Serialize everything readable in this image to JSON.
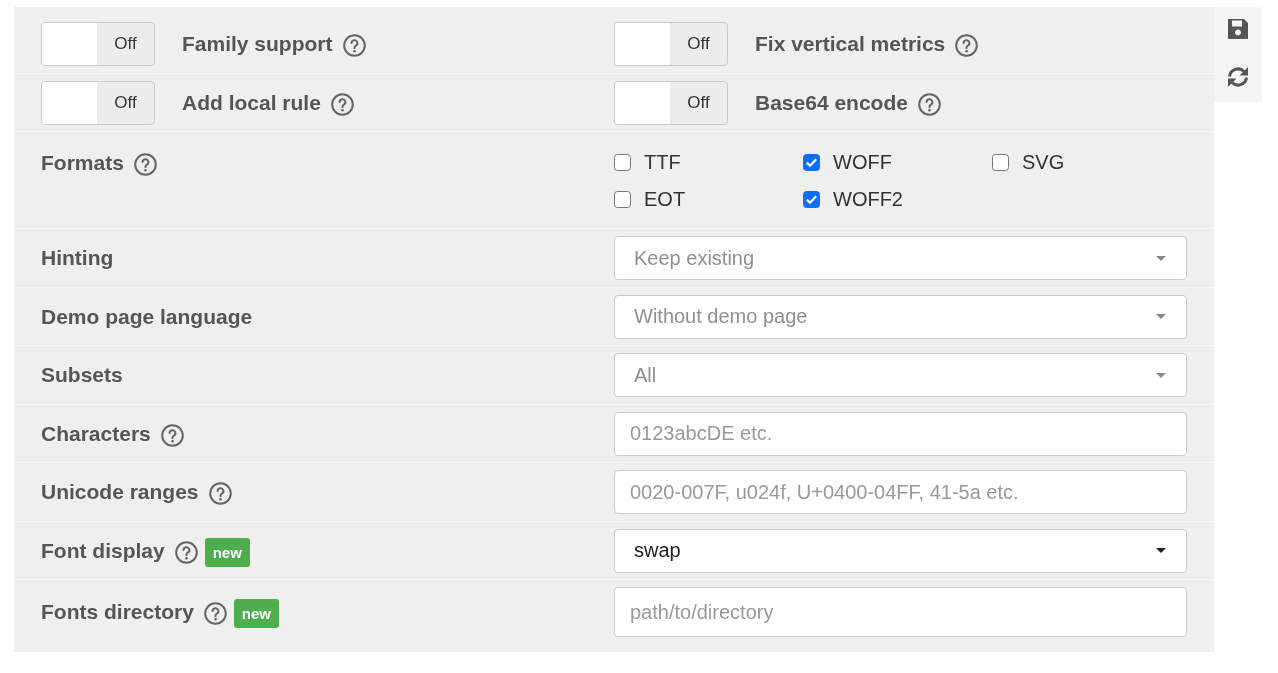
{
  "options_panel": {
    "toggles": [
      {
        "label": "Family support",
        "help": true,
        "on": false,
        "state_label": "Off"
      },
      {
        "label": "Fix vertical metrics",
        "help": true,
        "on": false,
        "state_label": "Off"
      },
      {
        "label": "Add local rule",
        "help": true,
        "on": false,
        "state_label": "Off"
      },
      {
        "label": "Base64 encode",
        "help": true,
        "on": false,
        "state_label": "Off"
      }
    ],
    "formats": {
      "label": "Formats",
      "help": true,
      "options": [
        {
          "label": "TTF",
          "checked": false
        },
        {
          "label": "WOFF",
          "checked": true
        },
        {
          "label": "SVG",
          "checked": false
        },
        {
          "label": "EOT",
          "checked": false
        },
        {
          "label": "WOFF2",
          "checked": true
        }
      ]
    },
    "settings": [
      {
        "label": "Hinting",
        "help": false,
        "kind": "select",
        "placeholder": "Keep existing"
      },
      {
        "label": "Demo page language",
        "help": false,
        "kind": "select",
        "placeholder": "Without demo page"
      },
      {
        "label": "Subsets",
        "help": false,
        "kind": "select",
        "placeholder": "All"
      },
      {
        "label": "Characters",
        "help": true,
        "kind": "text",
        "placeholder": "0123abcDE etc."
      },
      {
        "label": "Unicode ranges",
        "help": true,
        "kind": "text",
        "placeholder": "0020-007F, u024f, U+0400-04FF, 41-5a etc."
      },
      {
        "label": "Font display",
        "help": true,
        "badge": "new",
        "kind": "select",
        "value": "swap"
      },
      {
        "label": "Fonts directory",
        "help": true,
        "badge": "new",
        "kind": "text",
        "placeholder": "path/to/directory"
      }
    ]
  }
}
